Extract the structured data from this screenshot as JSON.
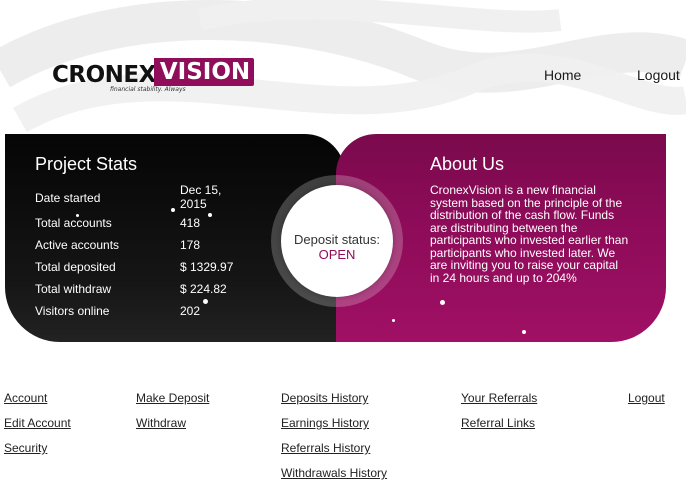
{
  "header": {
    "logo": {
      "part1": "CRONEX",
      "part2": "VISION",
      "tagline": "financial stability. Always"
    },
    "nav": [
      {
        "label": "Home"
      },
      {
        "label": "Logout"
      }
    ]
  },
  "stats": {
    "title": "Project Stats",
    "rows": [
      {
        "label": "Date started",
        "value": "Dec 15, 2015"
      },
      {
        "label": "Total accounts",
        "value": "418"
      },
      {
        "label": "Active accounts",
        "value": "178"
      },
      {
        "label": "Total deposited",
        "value": "$ 1329.97"
      },
      {
        "label": "Total withdraw",
        "value": "$ 224.82"
      },
      {
        "label": "Visitors online",
        "value": "202"
      }
    ]
  },
  "deposit": {
    "label": "Deposit status:",
    "value": "OPEN"
  },
  "about": {
    "title": "About Us",
    "text": "CronexVision is a new financial system based on the principle of the distribution of the cash flow. Funds are distributing between the participants who invested earlier than participants who invested later. We are inviting you to raise your capital in 24 hours and up to 204%"
  },
  "menu": {
    "col1": [
      {
        "label": "Account"
      },
      {
        "label": "Edit Account"
      },
      {
        "label": "Security"
      }
    ],
    "col2": [
      {
        "label": "Make Deposit"
      },
      {
        "label": "Withdraw"
      }
    ],
    "col3": [
      {
        "label": "Deposits History"
      },
      {
        "label": "Earnings History"
      },
      {
        "label": "Referrals History"
      },
      {
        "label": "Withdrawals History"
      }
    ],
    "col4": [
      {
        "label": "Your Referrals"
      },
      {
        "label": "Referral Links"
      }
    ],
    "col5": [
      {
        "label": "Logout"
      }
    ]
  },
  "colors": {
    "brand": "#8f0d5a",
    "panel_dark": "#0a0a0a"
  }
}
